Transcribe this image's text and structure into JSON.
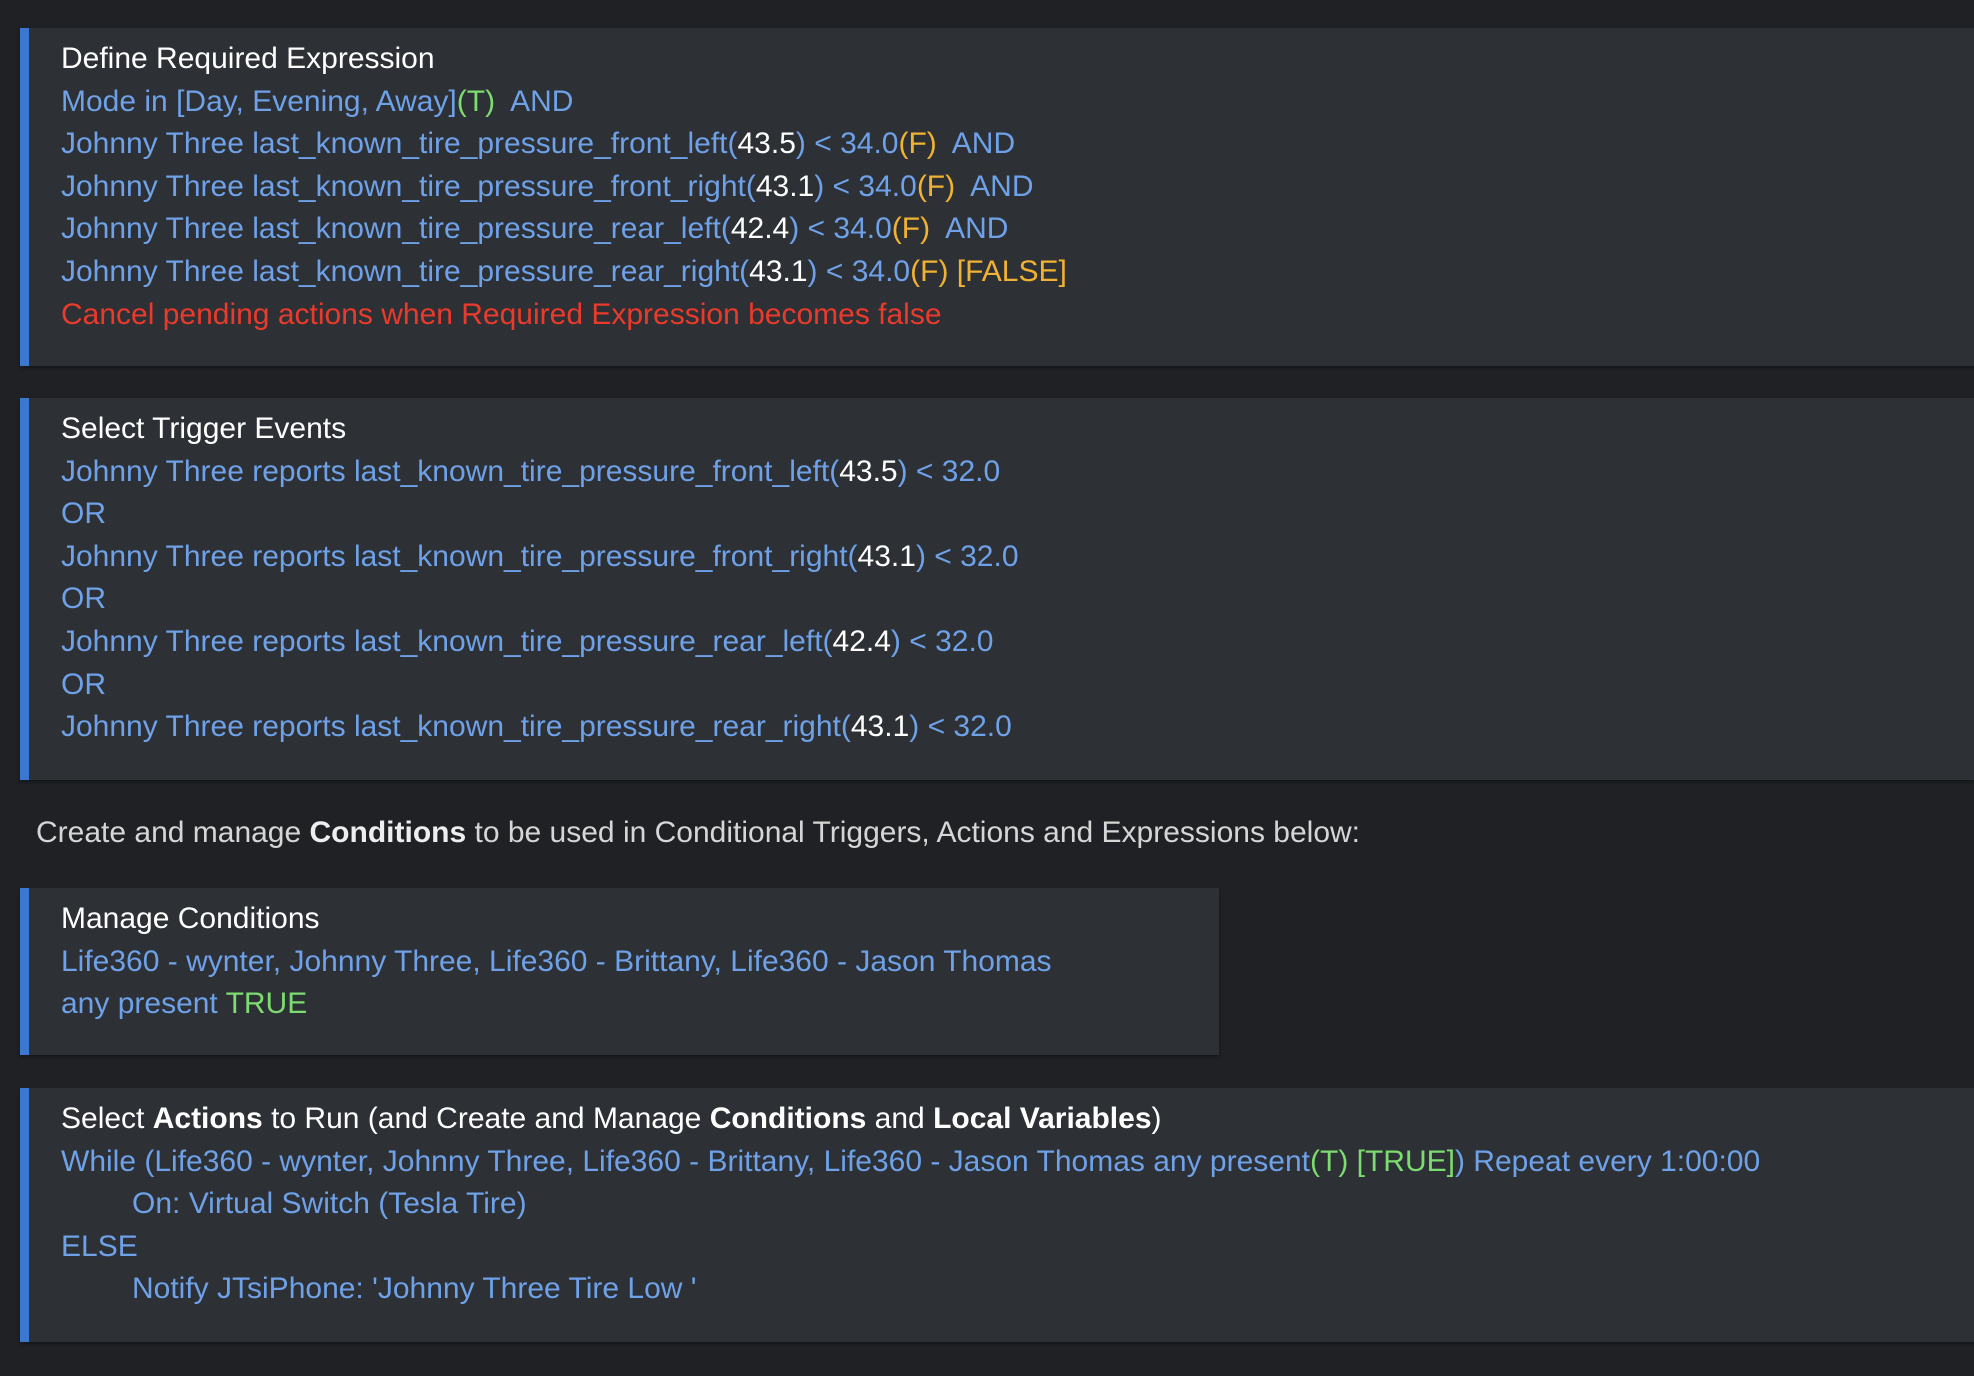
{
  "required_expression": {
    "title": "Define Required Expression",
    "mode_line": {
      "text": "Mode in [Day, Evening, Away]",
      "flag": "(T)",
      "op": "  AND"
    },
    "conditions": [
      {
        "label": "Johnny Three last_known_tire_pressure_front_left(",
        "value": "43.5",
        "compare": ") < 34.0",
        "flag": "(F)",
        "tail": "  AND"
      },
      {
        "label": "Johnny Three last_known_tire_pressure_front_right(",
        "value": "43.1",
        "compare": ") < 34.0",
        "flag": "(F)",
        "tail": "  AND"
      },
      {
        "label": "Johnny Three last_known_tire_pressure_rear_left(",
        "value": "42.4",
        "compare": ") < 34.0",
        "flag": "(F)",
        "tail": "  AND"
      },
      {
        "label": "Johnny Three last_known_tire_pressure_rear_right(",
        "value": "43.1",
        "compare": ") < 34.0",
        "flag": "(F) [FALSE]",
        "tail": ""
      }
    ],
    "cancel_text": "Cancel pending actions when Required Expression becomes false"
  },
  "trigger_events": {
    "title": "Select Trigger Events",
    "events": [
      {
        "label": "Johnny Three reports last_known_tire_pressure_front_left(",
        "value": "43.5",
        "compare": ") < 32.0"
      },
      {
        "label": "Johnny Three reports last_known_tire_pressure_front_right(",
        "value": "43.1",
        "compare": ") < 32.0"
      },
      {
        "label": "Johnny Three reports last_known_tire_pressure_rear_left(",
        "value": "42.4",
        "compare": ") < 32.0"
      },
      {
        "label": "Johnny Three reports last_known_tire_pressure_rear_right(",
        "value": "43.1",
        "compare": ") < 32.0"
      }
    ],
    "separator": "OR"
  },
  "intro": {
    "before": "Create and manage ",
    "bold": "Conditions",
    "after": " to be used in Conditional Triggers, Actions and Expressions below:"
  },
  "manage_conditions": {
    "title": "Manage Conditions",
    "devices": "Life360 - wynter, Johnny Three, Life360 - Brittany, Life360 - Jason Thomas",
    "state_label": "any present ",
    "state_value": "TRUE"
  },
  "actions": {
    "title_parts": {
      "p1": "Select ",
      "b1": "Actions",
      "p2": " to Run (and Create and Manage ",
      "b2": "Conditions",
      "p3": " and ",
      "b3": "Local Variables",
      "p4": ")"
    },
    "while_line": {
      "prefix": "While (Life360 - wynter, Johnny Three, Life360 - Brittany, Life360 - Jason Thomas any present",
      "flag": "(T) [TRUE]",
      "suffix": ") Repeat every 1:00:00"
    },
    "on_action": "On: Virtual Switch (Tesla Tire)",
    "else_label": "ELSE",
    "notify_action": "Notify JTsiPhone: 'Johnny Three Tire Low '"
  },
  "colors": {
    "background": "#1f2124",
    "panel": "#2d3034",
    "accent_border": "#3a78d1",
    "link_blue": "#6ea1e8",
    "true_green": "#7ddc6f",
    "false_orange": "#f0b232",
    "warning_red": "#ea3a2c"
  }
}
